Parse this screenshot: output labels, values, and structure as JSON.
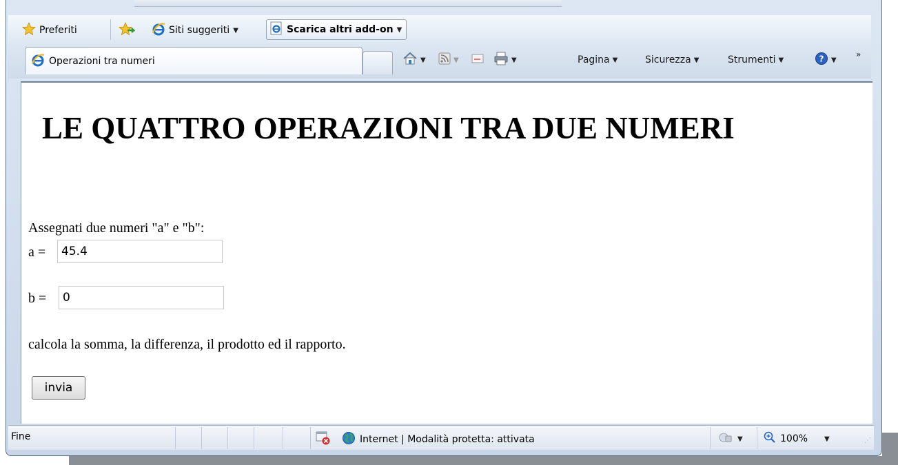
{
  "favorites_bar": {
    "favorites_label": "Preferiti",
    "suggested_sites_label": "Siti suggeriti",
    "addons_label": "Scarica altri add-on"
  },
  "tab": {
    "title": "Operazioni tra numeri"
  },
  "command_bar": {
    "page_label": "Pagina",
    "safety_label": "Sicurezza",
    "tools_label": "Strumenti",
    "overflow": "»"
  },
  "page": {
    "title": "LE QUATTRO OPERAZIONI TRA DUE NUMERI",
    "intro": "Assegnati due numeri \"a\" e \"b\":",
    "a_label": "a =",
    "a_value": "45.4",
    "b_label": "b =",
    "b_value": "0",
    "description": "calcola la somma, la differenza, il prodotto ed il rapporto.",
    "submit_label": "invia"
  },
  "status_bar": {
    "status": "Fine",
    "zone": "Internet | Modalità protetta: attivata",
    "zoom": "100%"
  },
  "colors": {
    "accent": "#1e6fc8",
    "frame": "#c8d6e8",
    "status_error": "#d32f2f"
  },
  "icons": [
    "star-icon",
    "add-favorite-icon",
    "ie-icon",
    "home-icon",
    "rss-icon",
    "mail-icon",
    "print-icon",
    "help-icon",
    "popup-blocked-icon",
    "globe-icon",
    "security-icon",
    "zoom-icon"
  ]
}
